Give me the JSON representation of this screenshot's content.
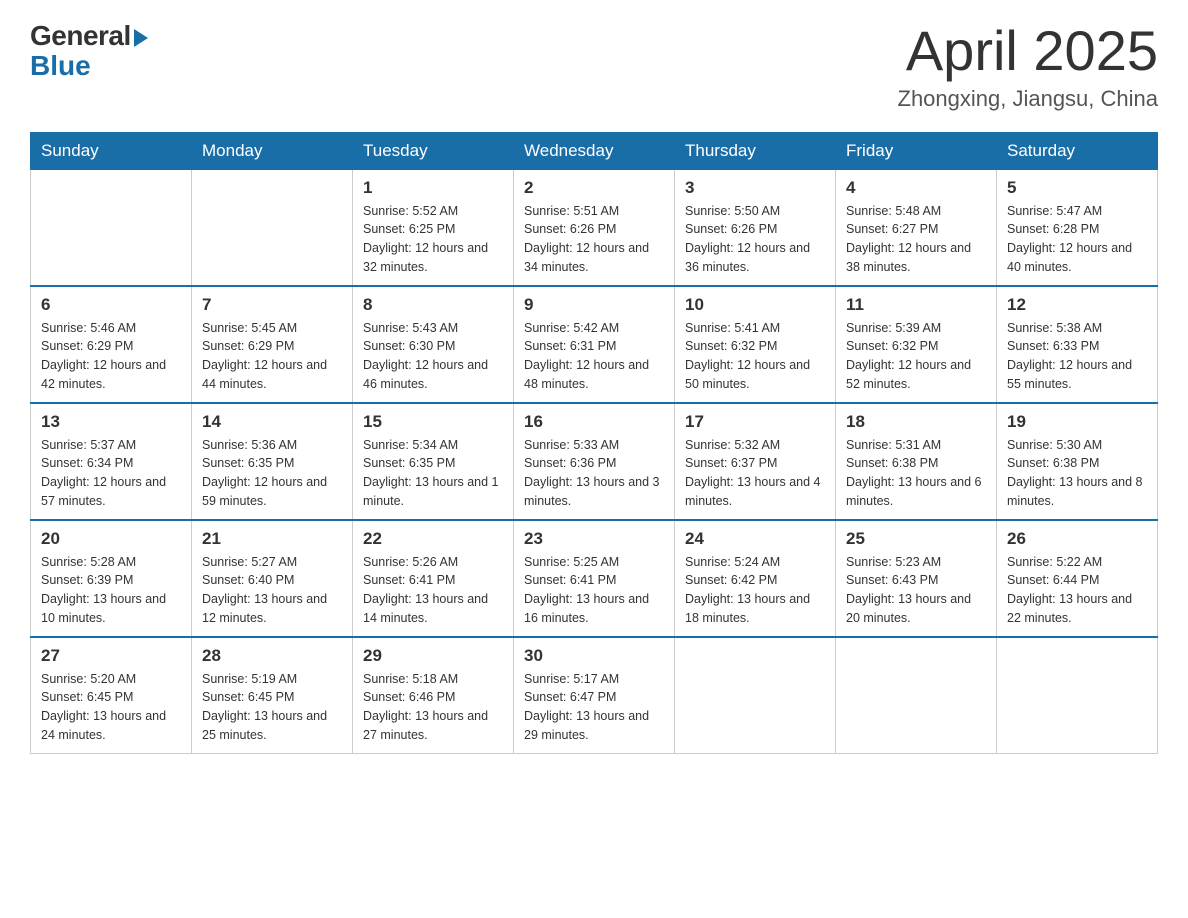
{
  "header": {
    "logo_general": "General",
    "logo_blue": "Blue",
    "month_title": "April 2025",
    "location": "Zhongxing, Jiangsu, China"
  },
  "days_of_week": [
    "Sunday",
    "Monday",
    "Tuesday",
    "Wednesday",
    "Thursday",
    "Friday",
    "Saturday"
  ],
  "weeks": [
    [
      {
        "day": "",
        "sunrise": "",
        "sunset": "",
        "daylight": ""
      },
      {
        "day": "",
        "sunrise": "",
        "sunset": "",
        "daylight": ""
      },
      {
        "day": "1",
        "sunrise": "Sunrise: 5:52 AM",
        "sunset": "Sunset: 6:25 PM",
        "daylight": "Daylight: 12 hours and 32 minutes."
      },
      {
        "day": "2",
        "sunrise": "Sunrise: 5:51 AM",
        "sunset": "Sunset: 6:26 PM",
        "daylight": "Daylight: 12 hours and 34 minutes."
      },
      {
        "day": "3",
        "sunrise": "Sunrise: 5:50 AM",
        "sunset": "Sunset: 6:26 PM",
        "daylight": "Daylight: 12 hours and 36 minutes."
      },
      {
        "day": "4",
        "sunrise": "Sunrise: 5:48 AM",
        "sunset": "Sunset: 6:27 PM",
        "daylight": "Daylight: 12 hours and 38 minutes."
      },
      {
        "day": "5",
        "sunrise": "Sunrise: 5:47 AM",
        "sunset": "Sunset: 6:28 PM",
        "daylight": "Daylight: 12 hours and 40 minutes."
      }
    ],
    [
      {
        "day": "6",
        "sunrise": "Sunrise: 5:46 AM",
        "sunset": "Sunset: 6:29 PM",
        "daylight": "Daylight: 12 hours and 42 minutes."
      },
      {
        "day": "7",
        "sunrise": "Sunrise: 5:45 AM",
        "sunset": "Sunset: 6:29 PM",
        "daylight": "Daylight: 12 hours and 44 minutes."
      },
      {
        "day": "8",
        "sunrise": "Sunrise: 5:43 AM",
        "sunset": "Sunset: 6:30 PM",
        "daylight": "Daylight: 12 hours and 46 minutes."
      },
      {
        "day": "9",
        "sunrise": "Sunrise: 5:42 AM",
        "sunset": "Sunset: 6:31 PM",
        "daylight": "Daylight: 12 hours and 48 minutes."
      },
      {
        "day": "10",
        "sunrise": "Sunrise: 5:41 AM",
        "sunset": "Sunset: 6:32 PM",
        "daylight": "Daylight: 12 hours and 50 minutes."
      },
      {
        "day": "11",
        "sunrise": "Sunrise: 5:39 AM",
        "sunset": "Sunset: 6:32 PM",
        "daylight": "Daylight: 12 hours and 52 minutes."
      },
      {
        "day": "12",
        "sunrise": "Sunrise: 5:38 AM",
        "sunset": "Sunset: 6:33 PM",
        "daylight": "Daylight: 12 hours and 55 minutes."
      }
    ],
    [
      {
        "day": "13",
        "sunrise": "Sunrise: 5:37 AM",
        "sunset": "Sunset: 6:34 PM",
        "daylight": "Daylight: 12 hours and 57 minutes."
      },
      {
        "day": "14",
        "sunrise": "Sunrise: 5:36 AM",
        "sunset": "Sunset: 6:35 PM",
        "daylight": "Daylight: 12 hours and 59 minutes."
      },
      {
        "day": "15",
        "sunrise": "Sunrise: 5:34 AM",
        "sunset": "Sunset: 6:35 PM",
        "daylight": "Daylight: 13 hours and 1 minute."
      },
      {
        "day": "16",
        "sunrise": "Sunrise: 5:33 AM",
        "sunset": "Sunset: 6:36 PM",
        "daylight": "Daylight: 13 hours and 3 minutes."
      },
      {
        "day": "17",
        "sunrise": "Sunrise: 5:32 AM",
        "sunset": "Sunset: 6:37 PM",
        "daylight": "Daylight: 13 hours and 4 minutes."
      },
      {
        "day": "18",
        "sunrise": "Sunrise: 5:31 AM",
        "sunset": "Sunset: 6:38 PM",
        "daylight": "Daylight: 13 hours and 6 minutes."
      },
      {
        "day": "19",
        "sunrise": "Sunrise: 5:30 AM",
        "sunset": "Sunset: 6:38 PM",
        "daylight": "Daylight: 13 hours and 8 minutes."
      }
    ],
    [
      {
        "day": "20",
        "sunrise": "Sunrise: 5:28 AM",
        "sunset": "Sunset: 6:39 PM",
        "daylight": "Daylight: 13 hours and 10 minutes."
      },
      {
        "day": "21",
        "sunrise": "Sunrise: 5:27 AM",
        "sunset": "Sunset: 6:40 PM",
        "daylight": "Daylight: 13 hours and 12 minutes."
      },
      {
        "day": "22",
        "sunrise": "Sunrise: 5:26 AM",
        "sunset": "Sunset: 6:41 PM",
        "daylight": "Daylight: 13 hours and 14 minutes."
      },
      {
        "day": "23",
        "sunrise": "Sunrise: 5:25 AM",
        "sunset": "Sunset: 6:41 PM",
        "daylight": "Daylight: 13 hours and 16 minutes."
      },
      {
        "day": "24",
        "sunrise": "Sunrise: 5:24 AM",
        "sunset": "Sunset: 6:42 PM",
        "daylight": "Daylight: 13 hours and 18 minutes."
      },
      {
        "day": "25",
        "sunrise": "Sunrise: 5:23 AM",
        "sunset": "Sunset: 6:43 PM",
        "daylight": "Daylight: 13 hours and 20 minutes."
      },
      {
        "day": "26",
        "sunrise": "Sunrise: 5:22 AM",
        "sunset": "Sunset: 6:44 PM",
        "daylight": "Daylight: 13 hours and 22 minutes."
      }
    ],
    [
      {
        "day": "27",
        "sunrise": "Sunrise: 5:20 AM",
        "sunset": "Sunset: 6:45 PM",
        "daylight": "Daylight: 13 hours and 24 minutes."
      },
      {
        "day": "28",
        "sunrise": "Sunrise: 5:19 AM",
        "sunset": "Sunset: 6:45 PM",
        "daylight": "Daylight: 13 hours and 25 minutes."
      },
      {
        "day": "29",
        "sunrise": "Sunrise: 5:18 AM",
        "sunset": "Sunset: 6:46 PM",
        "daylight": "Daylight: 13 hours and 27 minutes."
      },
      {
        "day": "30",
        "sunrise": "Sunrise: 5:17 AM",
        "sunset": "Sunset: 6:47 PM",
        "daylight": "Daylight: 13 hours and 29 minutes."
      },
      {
        "day": "",
        "sunrise": "",
        "sunset": "",
        "daylight": ""
      },
      {
        "day": "",
        "sunrise": "",
        "sunset": "",
        "daylight": ""
      },
      {
        "day": "",
        "sunrise": "",
        "sunset": "",
        "daylight": ""
      }
    ]
  ]
}
